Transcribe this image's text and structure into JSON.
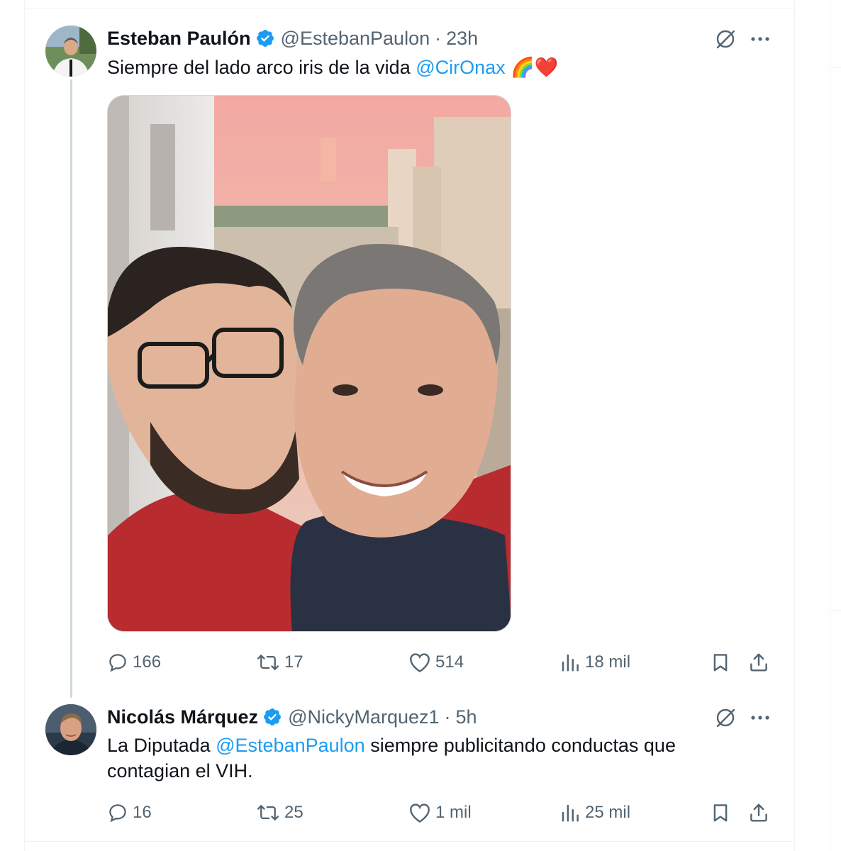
{
  "tweets": [
    {
      "author": "Esteban Paulón",
      "handle": "@EstebanPaulon",
      "separator": "·",
      "time": "23h",
      "text_prefix": "Siempre del lado arco iris de la vida  ",
      "mention": "@CirOnax",
      "emojis": " 🌈❤️",
      "stats": {
        "replies": "166",
        "reposts": "17",
        "likes": "514",
        "views": "18 mil"
      }
    },
    {
      "author": "Nicolás Márquez",
      "handle": "@NickyMarquez1",
      "separator": "·",
      "time": "5h",
      "text_prefix": "La Diputada ",
      "mention": "@EstebanPaulon",
      "text_suffix": " siempre publicitando conductas que contagian el VIH.",
      "stats": {
        "replies": "16",
        "reposts": "25",
        "likes": "1 mil",
        "views": "25 mil"
      }
    }
  ],
  "colors": {
    "accent": "#1d9bf0",
    "text": "#0f1419",
    "secondary": "#536471",
    "border": "#eff3f4",
    "thread_line": "#cfd9de"
  },
  "icons": [
    "verified-badge-icon",
    "grok-icon",
    "more-icon",
    "reply-icon",
    "repost-icon",
    "like-icon",
    "views-icon",
    "bookmark-icon",
    "share-icon"
  ]
}
